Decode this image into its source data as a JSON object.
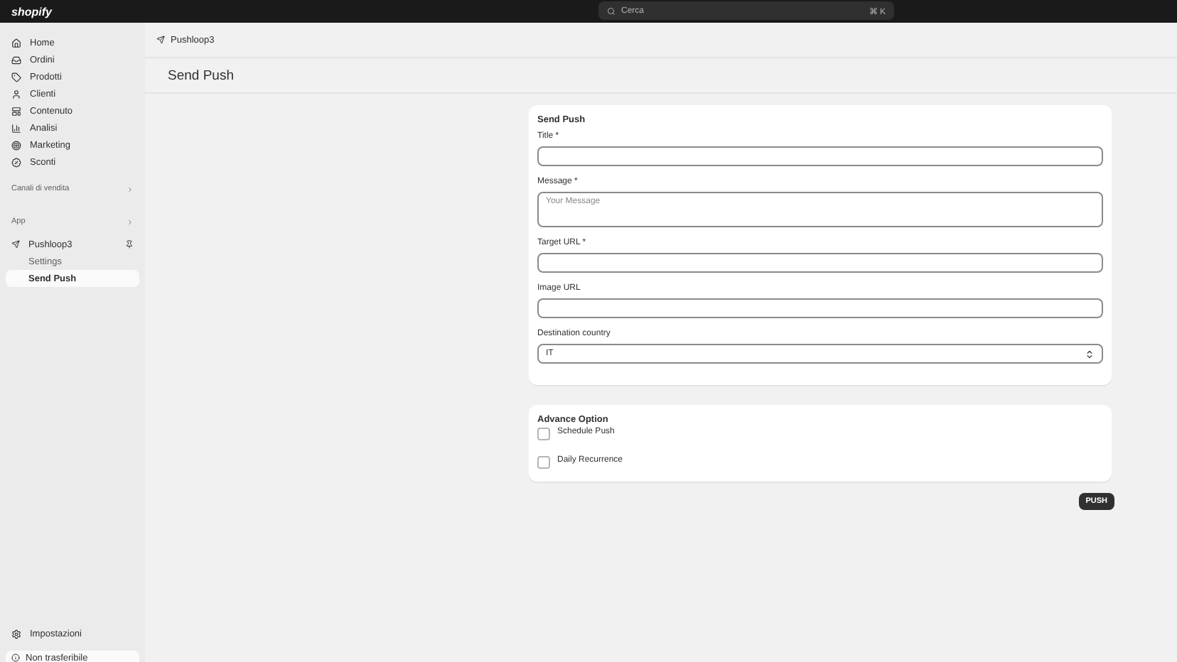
{
  "topbar": {
    "logo": "shopify",
    "search": {
      "placeholder": "Cerca",
      "shortcut": "⌘ K"
    }
  },
  "sidebar": {
    "items": [
      {
        "label": "Home"
      },
      {
        "label": "Ordini"
      },
      {
        "label": "Prodotti"
      },
      {
        "label": "Clienti"
      },
      {
        "label": "Contenuto"
      },
      {
        "label": "Analisi"
      },
      {
        "label": "Marketing"
      },
      {
        "label": "Sconti"
      }
    ],
    "sections": [
      {
        "label": "Canali di vendita"
      },
      {
        "label": "App"
      }
    ],
    "app": {
      "label": "Pushloop3",
      "children": [
        {
          "label": "Settings",
          "selected": false
        },
        {
          "label": "Send Push",
          "selected": true
        }
      ]
    },
    "settings": "Impostazioni",
    "footer": "Non trasferibile"
  },
  "breadcrumb": "Pushloop3",
  "page_title": "Send Push",
  "form": {
    "title": "Send Push",
    "fields": [
      {
        "label": "Title *",
        "kind": "input"
      },
      {
        "label": "Message *",
        "kind": "textarea",
        "placeholder": "Your Message"
      },
      {
        "label": "Target URL *",
        "kind": "input"
      },
      {
        "label": "Image URL",
        "kind": "input"
      },
      {
        "label": "Destination country",
        "kind": "select",
        "value": "IT"
      }
    ]
  },
  "advanced": {
    "title": "Advance Option",
    "options": [
      {
        "label": "Schedule Push",
        "checked": false
      },
      {
        "label": "Daily Recurrence",
        "checked": false
      }
    ]
  },
  "submit": "PUSH"
}
